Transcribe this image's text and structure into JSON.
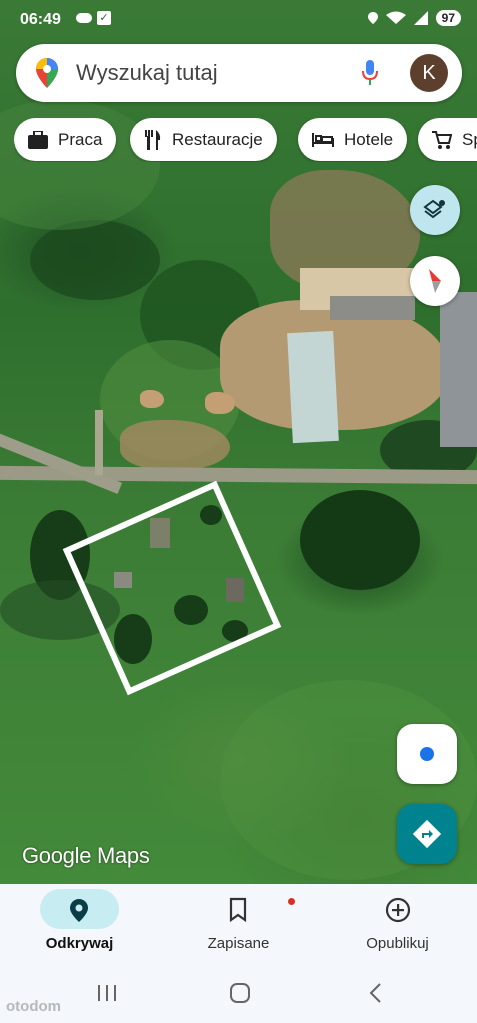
{
  "status_bar": {
    "time": "06:49",
    "battery": "97",
    "icons": [
      "cloud-icon",
      "checkbox-icon",
      "location-icon",
      "wifi-icon",
      "signal-icon",
      "battery-icon"
    ]
  },
  "search": {
    "placeholder": "Wyszukaj tutaj",
    "avatar_letter": "K"
  },
  "chips": [
    {
      "label": "Praca",
      "icon": "briefcase-icon"
    },
    {
      "label": "Restauracje",
      "icon": "restaurant-icon"
    },
    {
      "label": "Hotele",
      "icon": "hotel-icon"
    },
    {
      "label": "Sp",
      "icon": "shopping-cart-icon"
    }
  ],
  "map": {
    "watermark": "Google Maps",
    "layer_type": "satellite",
    "controls": [
      "layers-icon",
      "compass-icon",
      "my-location-icon",
      "directions-icon"
    ]
  },
  "bottom_nav": {
    "items": [
      {
        "label": "Odkrywaj",
        "icon": "explore-pin-icon",
        "active": true
      },
      {
        "label": "Zapisane",
        "icon": "bookmark-icon",
        "active": false
      },
      {
        "label": "Opublikuj",
        "icon": "add-circle-icon",
        "active": false
      }
    ]
  },
  "overlay_watermark": "otodom",
  "colors": {
    "accent": "#00838f",
    "active_pill": "#c7edf2",
    "location_blue": "#1a73e8"
  }
}
